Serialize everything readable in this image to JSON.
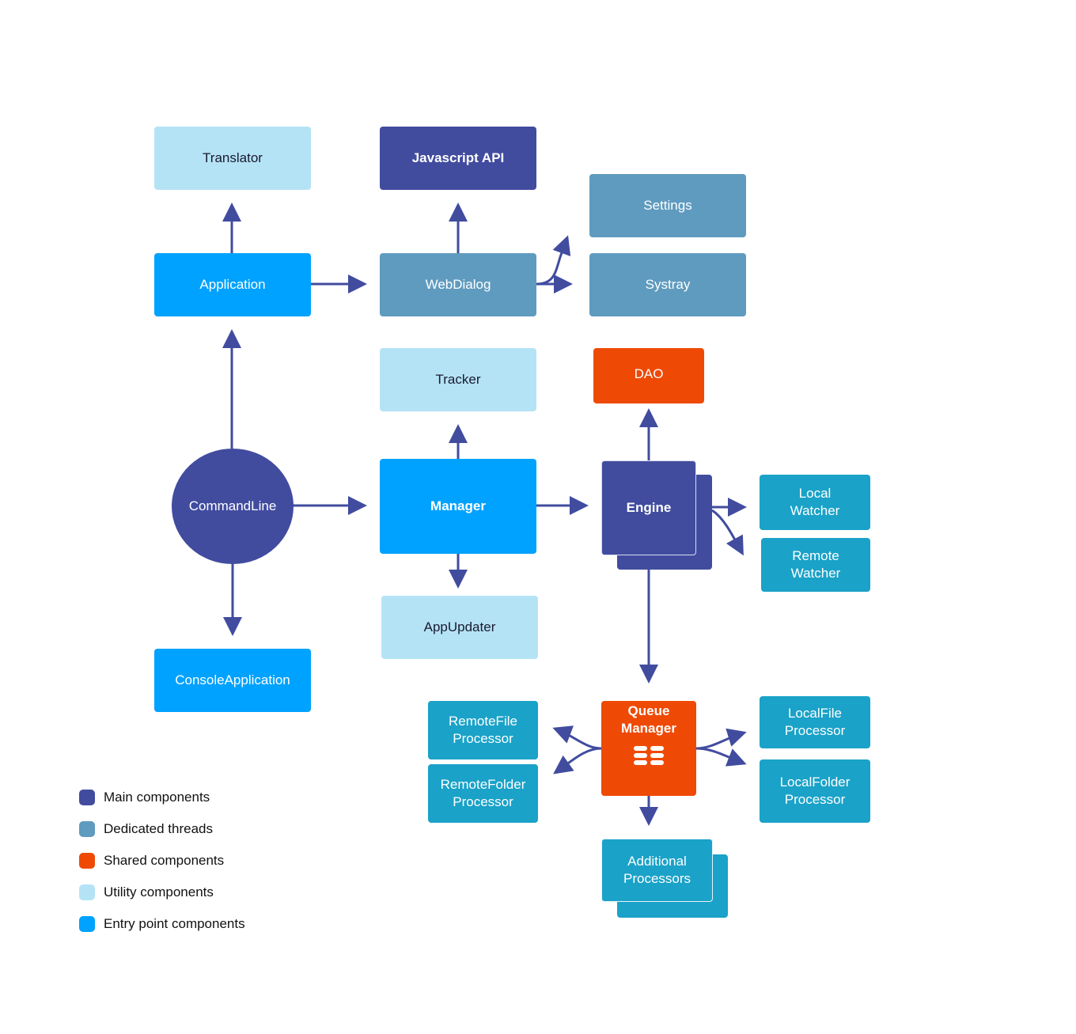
{
  "colors": {
    "main": "#414c9f",
    "thread": "#5f9bbf",
    "shared": "#ee4a06",
    "utility": "#b5e3f6",
    "entry": "#00a2ff",
    "processor": "#1aa2c8",
    "arrow": "#414c9f"
  },
  "nodes": {
    "translator": "Translator",
    "javascript_api": "Javascript API",
    "settings": "Settings",
    "application": "Application",
    "webdialog": "WebDialog",
    "systray": "Systray",
    "tracker": "Tracker",
    "dao": "DAO",
    "commandline": "CommandLine",
    "manager": "Manager",
    "engine": "Engine",
    "local_watcher": "Local Watcher",
    "remote_watcher": "Remote Watcher",
    "appupdater": "AppUpdater",
    "console_application": "ConsoleApplication",
    "remotefile_processor": "RemoteFile Processor",
    "remotefolder_processor": "RemoteFolder Processor",
    "queue_manager": "Queue Manager",
    "queue_manager_icon": "queue-icon",
    "localfile_processor": "LocalFile Processor",
    "localfolder_processor": "LocalFolder Processor",
    "additional_processors": "Additional Processors"
  },
  "edges": [
    [
      "application",
      "translator"
    ],
    [
      "application",
      "webdialog"
    ],
    [
      "webdialog",
      "javascript_api"
    ],
    [
      "webdialog",
      "settings"
    ],
    [
      "webdialog",
      "systray"
    ],
    [
      "commandline",
      "application"
    ],
    [
      "commandline",
      "manager"
    ],
    [
      "commandline",
      "console_application"
    ],
    [
      "manager",
      "tracker"
    ],
    [
      "manager",
      "engine"
    ],
    [
      "manager",
      "appupdater"
    ],
    [
      "engine",
      "dao"
    ],
    [
      "engine",
      "local_watcher"
    ],
    [
      "engine",
      "remote_watcher"
    ],
    [
      "engine",
      "queue_manager"
    ],
    [
      "queue_manager",
      "remotefile_processor"
    ],
    [
      "queue_manager",
      "remotefolder_processor"
    ],
    [
      "queue_manager",
      "localfile_processor"
    ],
    [
      "queue_manager",
      "localfolder_processor"
    ],
    [
      "queue_manager",
      "additional_processors"
    ]
  ],
  "legend": [
    {
      "label": "Main components",
      "color": "#414c9f"
    },
    {
      "label": "Dedicated threads",
      "color": "#5f9bbf"
    },
    {
      "label": "Shared components",
      "color": "#ee4a06"
    },
    {
      "label": "Utility components",
      "color": "#b5e3f6"
    },
    {
      "label": "Entry point components",
      "color": "#00a2ff"
    }
  ]
}
